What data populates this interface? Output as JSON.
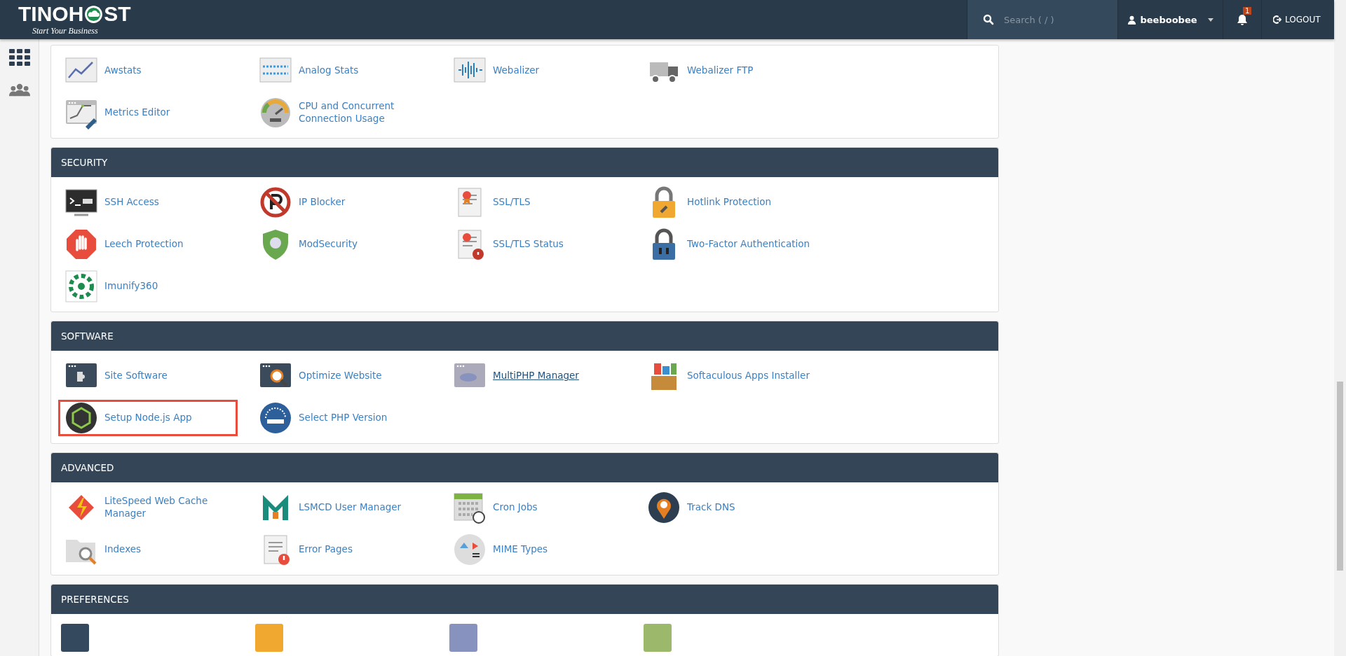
{
  "header": {
    "logo_left": "TINOH",
    "logo_right": "ST",
    "tagline": "Start Your Business",
    "search": {
      "placeholder": "Search ( / )"
    },
    "user": "beeboobee",
    "notifications": "1",
    "logout": "LOGOUT"
  },
  "sections": [
    {
      "items": [
        {
          "label": "Awstats",
          "hovered": false,
          "highlighted": false
        },
        {
          "label": "Analog Stats",
          "hovered": false,
          "highlighted": false
        },
        {
          "label": "Webalizer",
          "hovered": false,
          "highlighted": false
        },
        {
          "label": "Webalizer FTP",
          "hovered": false,
          "highlighted": false
        },
        {
          "label": "Metrics Editor",
          "hovered": false,
          "highlighted": false
        },
        {
          "label": "CPU and Concurrent Connection Usage",
          "hovered": false,
          "highlighted": false
        }
      ]
    },
    {
      "title": "SECURITY",
      "items": [
        {
          "label": "SSH Access",
          "hovered": false,
          "highlighted": false
        },
        {
          "label": "IP Blocker",
          "hovered": false,
          "highlighted": false
        },
        {
          "label": "SSL/TLS",
          "hovered": false,
          "highlighted": false
        },
        {
          "label": "Hotlink Protection",
          "hovered": false,
          "highlighted": false
        },
        {
          "label": "Leech Protection",
          "hovered": false,
          "highlighted": false
        },
        {
          "label": "ModSecurity",
          "hovered": false,
          "highlighted": false
        },
        {
          "label": "SSL/TLS Status",
          "hovered": false,
          "highlighted": false
        },
        {
          "label": "Two-Factor Authentication",
          "hovered": false,
          "highlighted": false
        },
        {
          "label": "Imunify360",
          "hovered": false,
          "highlighted": false
        }
      ]
    },
    {
      "title": "SOFTWARE",
      "items": [
        {
          "label": "Site Software",
          "hovered": false,
          "highlighted": false
        },
        {
          "label": "Optimize Website",
          "hovered": false,
          "highlighted": false
        },
        {
          "label": "MultiPHP Manager",
          "hovered": true,
          "highlighted": false
        },
        {
          "label": "Softaculous Apps Installer",
          "hovered": false,
          "highlighted": false
        },
        {
          "label": "Setup Node.js App",
          "hovered": false,
          "highlighted": true
        },
        {
          "label": "Select PHP Version",
          "hovered": false,
          "highlighted": false
        }
      ]
    },
    {
      "title": "ADVANCED",
      "items": [
        {
          "label": "LiteSpeed Web Cache Manager",
          "hovered": false,
          "highlighted": false
        },
        {
          "label": "LSMCD User Manager",
          "hovered": false,
          "highlighted": false
        },
        {
          "label": "Cron Jobs",
          "hovered": false,
          "highlighted": false
        },
        {
          "label": "Track DNS",
          "hovered": false,
          "highlighted": false
        },
        {
          "label": "Indexes",
          "hovered": false,
          "highlighted": false
        },
        {
          "label": "Error Pages",
          "hovered": false,
          "highlighted": false
        },
        {
          "label": "MIME Types",
          "hovered": false,
          "highlighted": false
        }
      ]
    },
    {
      "title": "PREFERENCES"
    }
  ]
}
